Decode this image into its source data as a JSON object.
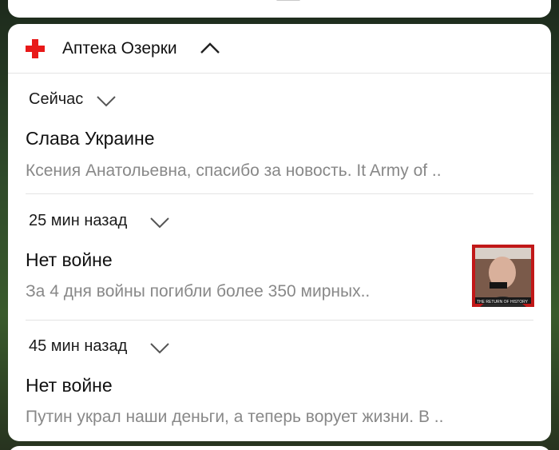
{
  "app": {
    "name": "Аптека Озерки",
    "icon": "red-cross-icon"
  },
  "notifications": [
    {
      "time": "Сейчас",
      "title": "Слава Украине",
      "text": "Ксения Анатольевна, спасибо за новость. It Army of .."
    },
    {
      "time": "25 мин назад",
      "title": "Нет войне",
      "text": "За 4 дня войны погибли более 350 мирных..",
      "thumbnail_caption": "THE RETURN OF HISTORY"
    },
    {
      "time": "45 мин назад",
      "title": "Нет войне",
      "text": "Путин украл наши деньги, а теперь ворует жизни. В .."
    }
  ],
  "colors": {
    "brand": "#e81919",
    "title": "#111111",
    "secondary": "#888888"
  }
}
